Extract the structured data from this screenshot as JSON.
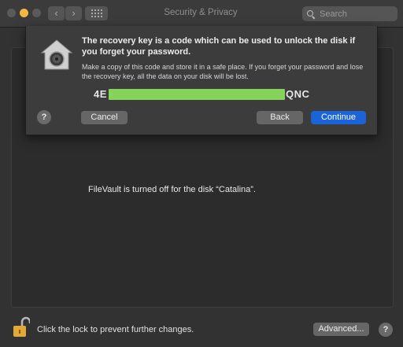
{
  "window": {
    "title": "Security & Privacy",
    "search_placeholder": "Search"
  },
  "toolbar": {
    "back_glyph": "‹",
    "forward_glyph": "›"
  },
  "sheet": {
    "heading": "The recovery key is a code which can be used to unlock the disk if you forget your password.",
    "body": "Make a copy of this code and store it in a safe place. If you forget your password and lose the recovery key, all the data on your disk will be lost.",
    "key_visible_prefix": "4E",
    "key_visible_suffix": "QNC",
    "help_label": "?",
    "cancel_label": "Cancel",
    "back_label": "Back",
    "continue_label": "Continue"
  },
  "panel": {
    "status_text": "FileVault is turned off for the disk “Catalina”."
  },
  "footer": {
    "lock_text": "Click the lock to prevent further changes.",
    "advanced_label": "Advanced...",
    "help_label": "?"
  },
  "colors": {
    "accent": "#1a64d8",
    "redaction": "#86d35a"
  },
  "icons": [
    "search-icon",
    "grid-icon",
    "filevault-house-icon",
    "lock-open-icon",
    "help-icon"
  ]
}
